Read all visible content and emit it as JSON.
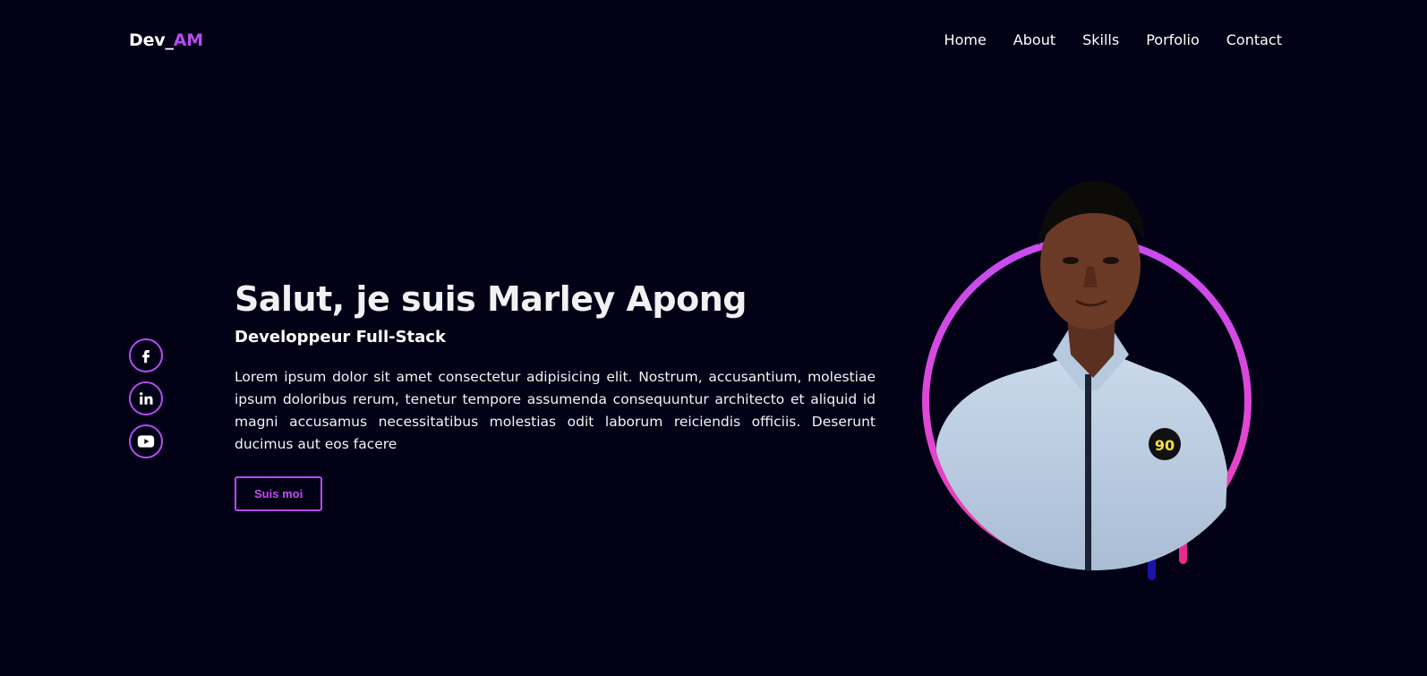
{
  "logo": {
    "prefix": "Dev_",
    "accent": "AM"
  },
  "nav": [
    {
      "label": "Home"
    },
    {
      "label": "About"
    },
    {
      "label": "Skills"
    },
    {
      "label": "Porfolio"
    },
    {
      "label": "Contact"
    }
  ],
  "social": [
    {
      "icon": "facebook-icon"
    },
    {
      "icon": "linkedin-icon"
    },
    {
      "icon": "youtube-icon"
    }
  ],
  "hero": {
    "title": "Salut, je suis Marley Apong",
    "subtitle": "Developpeur Full-Stack",
    "description": "Lorem ipsum dolor sit amet consectetur adipisicing elit. Nostrum, accusantium, molestiae ipsum doloribus rerum, tenetur tempore assumenda consequuntur architecto et aliquid id magni accusamus necessitatibus molestias odit laborum reiciendis officiis. Deserunt ducimus aut eos facere",
    "cta_label": "Suis moi"
  },
  "portrait": {
    "badge_text": "90"
  },
  "colors": {
    "background": "#020116",
    "accent": "#b44cf0",
    "ring_gradient": [
      "#c64cf0",
      "#ef3aa0"
    ],
    "drip_blue": "#1a14a8",
    "drip_pink": "#e62b8f"
  }
}
